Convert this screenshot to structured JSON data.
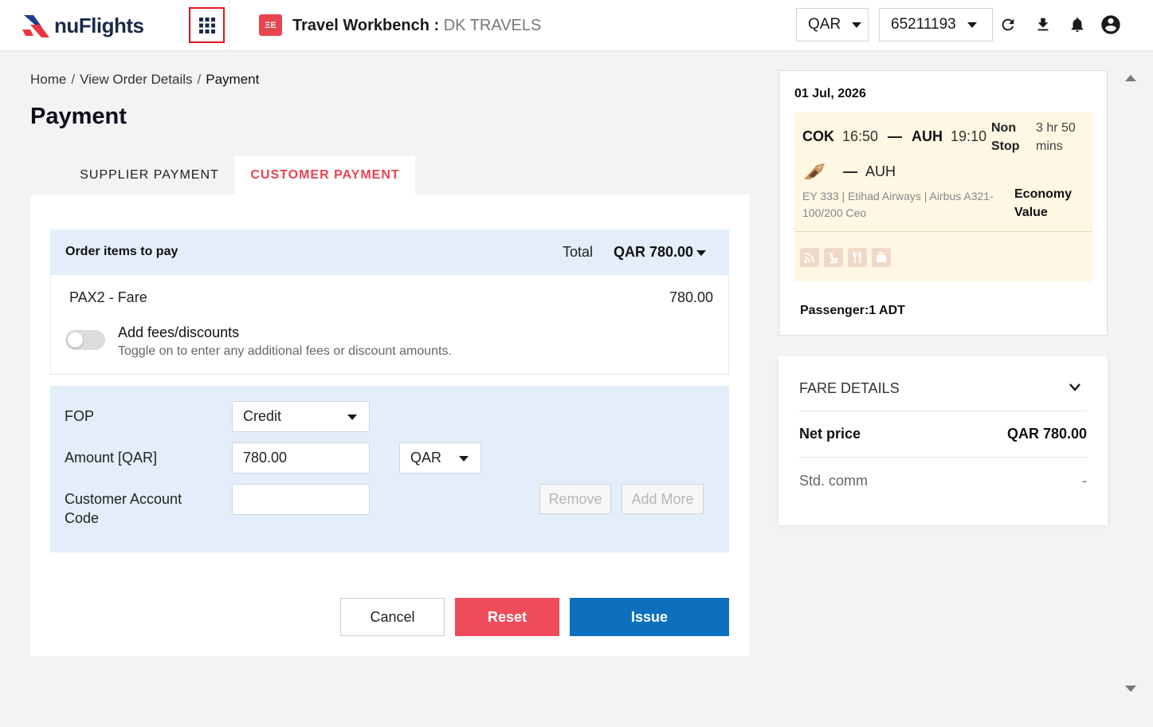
{
  "header": {
    "brand": "nuFlights",
    "app_title": "Travel Workbench :",
    "agency": "DK TRAVELS",
    "wb_icon_text": "ΞE",
    "currency": "QAR",
    "account": "65211193"
  },
  "breadcrumb": {
    "items": [
      "Home",
      "View Order Details"
    ],
    "current": "Payment",
    "separator": "/"
  },
  "page_title": "Payment",
  "tabs": [
    {
      "label": "SUPPLIER PAYMENT",
      "active": false
    },
    {
      "label": "CUSTOMER PAYMENT",
      "active": true
    }
  ],
  "order": {
    "title": "Order items to pay",
    "total_label": "Total",
    "total_value": "QAR 780.00",
    "item_label": "PAX2  - Fare",
    "item_amount": "780.00",
    "fees_title": "Add fees/discounts",
    "fees_subtitle": "Toggle on to enter any additional fees or discount amounts.",
    "fees_enabled": false
  },
  "fop": {
    "fop_label": "FOP",
    "fop_value": "Credit",
    "amount_label": "Amount [QAR]",
    "amount_value": "780.00",
    "currency_value": "QAR",
    "account_label": "Customer Account Code",
    "account_value": "",
    "remove_label": "Remove",
    "add_more_label": "Add More"
  },
  "actions": {
    "cancel": "Cancel",
    "reset": "Reset",
    "issue": "Issue"
  },
  "flight": {
    "date": "01 Jul, 2026",
    "origin": "COK",
    "dep_time": "16:50",
    "dash": "—",
    "destination": "AUH",
    "arr_time": "19:10",
    "stops": "Non Stop",
    "duration": "3 hr 50 mins",
    "via_dash": "—",
    "via": "AUH",
    "info": "EY 333 | Etihad Airways | Airbus A321-100/200 Ceo",
    "cabin": "Economy Value",
    "amenities": [
      "wifi-icon",
      "seat-icon",
      "meal-icon",
      "baggage-icon"
    ],
    "passenger": "Passenger:1 ADT"
  },
  "fare": {
    "title": "FARE DETAILS",
    "net_label": "Net price",
    "net_value": "QAR 780.00",
    "comm_label": "Std. comm",
    "comm_value": "-"
  },
  "colors": {
    "accent_red": "#e94452",
    "reset_red": "#ee4c5b",
    "issue_blue": "#0c70bf",
    "panel_blue": "#e3eefa",
    "flight_yellow": "#fdf7e3"
  }
}
